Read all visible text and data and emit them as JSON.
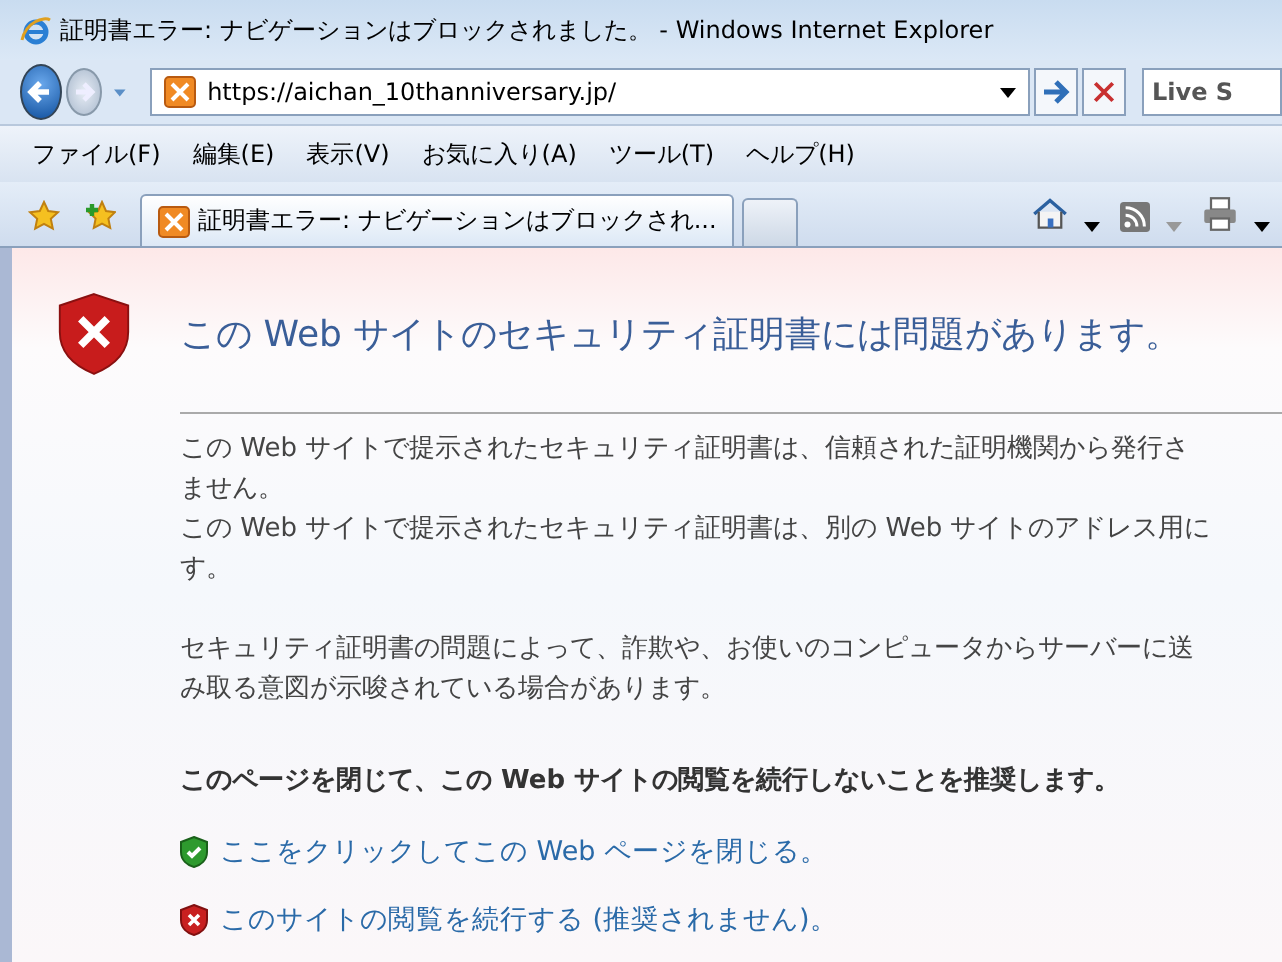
{
  "window": {
    "title": "証明書エラー: ナビゲーションはブロックされました。 - Windows Internet Explorer"
  },
  "address_bar": {
    "value": "https://aichan_10thanniversary.jp/"
  },
  "search": {
    "placeholder": "Live S"
  },
  "menu": [
    "ファイル(F)",
    "編集(E)",
    "表示(V)",
    "お気に入り(A)",
    "ツール(T)",
    "ヘルプ(H)"
  ],
  "tabs": [
    {
      "label": "証明書エラー: ナビゲーションはブロックされ...",
      "selected": true
    },
    {
      "selected": false
    }
  ],
  "page": {
    "heading": "この Web サイトのセキュリティ証明書には問題があります。",
    "paragraphs": [
      [
        "この Web サイトで提示されたセキュリティ証明書は、信頼された証明機関から発行さ",
        "ません。",
        "この Web サイトで提示されたセキュリティ証明書は、別の Web サイトのアドレス用に",
        "す。"
      ],
      [
        "セキュリティ証明書の問題によって、詐欺や、お使いのコンピュータからサーバーに送",
        "み取る意図が示唆されている場合があります。"
      ]
    ],
    "recommendation": "このページを閉じて、この Web サイトの閲覧を続行しないことを推奨します。",
    "links": [
      {
        "kind": "safe",
        "text": "ここをクリックしてこの Web ページを閉じる。"
      },
      {
        "kind": "danger",
        "text": "このサイトの閲覧を続行する (推奨されません)。"
      }
    ]
  }
}
